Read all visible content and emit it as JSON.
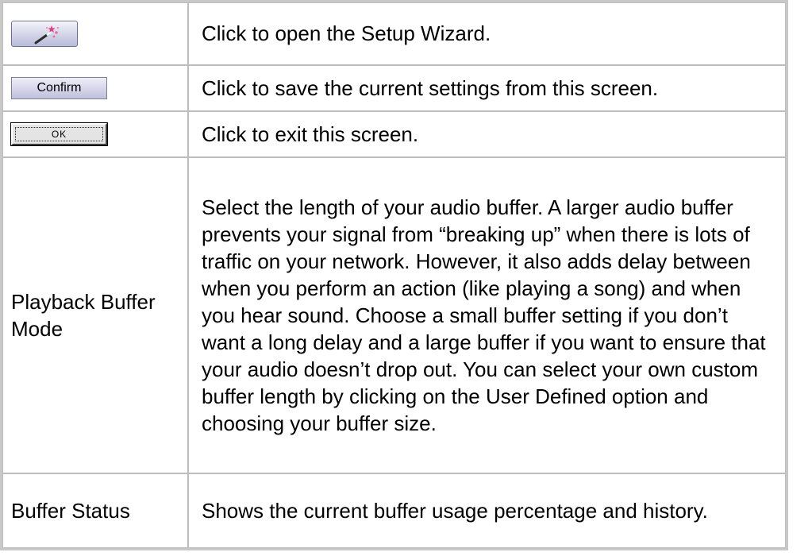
{
  "rows": [
    {
      "control": "wizard",
      "icon": "magic-wand-icon",
      "description": "Click to open the Setup Wizard."
    },
    {
      "control": "button",
      "label": "Confirm",
      "description": "Click to save the current settings from this screen."
    },
    {
      "control": "button",
      "label": "OK",
      "description": "Click to exit this screen."
    },
    {
      "control": "text",
      "label": "Playback Buffer Mode",
      "description": "Select the length of your audio buffer. A larger audio buffer prevents your signal from “breaking up” when there is lots of traffic on your network. However, it also adds delay between when you perform an action (like playing a song) and when you hear sound. Choose a small buffer setting if you don’t want a long delay and a large buffer if you want to ensure that your audio doesn’t drop out. You can select your own custom buffer length by clicking on the User Defined option and choosing your buffer size."
    },
    {
      "control": "text",
      "label": "Buffer Status",
      "description": "Shows the current buffer usage percentage and history."
    }
  ],
  "colors": {
    "table_border": "#c8c8c8",
    "wizard_button": "#c6c8e0",
    "wand_sparkles": "#e0408a"
  }
}
